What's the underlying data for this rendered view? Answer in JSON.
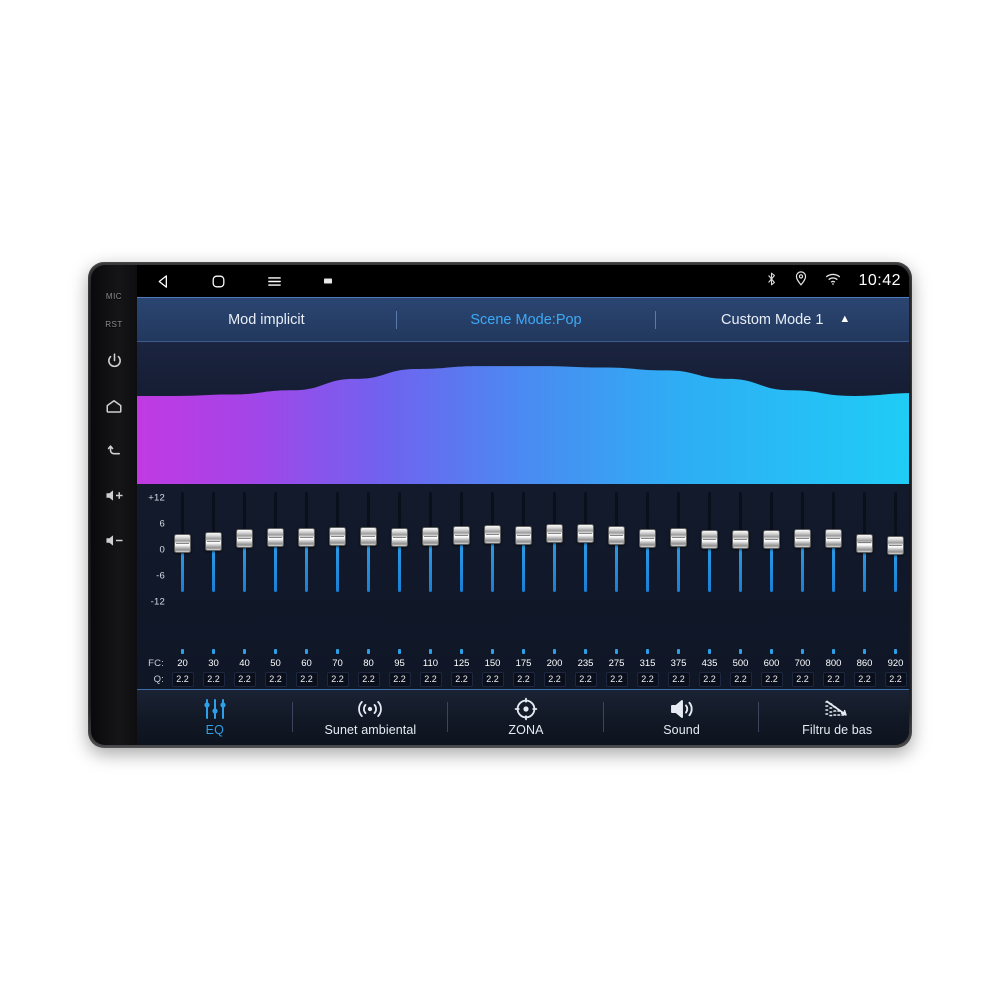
{
  "device": {
    "bezel_buttons": [
      {
        "name": "mic-label",
        "label": "MIC",
        "type": "text"
      },
      {
        "name": "reset-label",
        "label": "RST",
        "type": "text"
      },
      {
        "name": "power-button",
        "label": "power-icon",
        "type": "icon"
      },
      {
        "name": "home-button",
        "label": "home-icon",
        "type": "icon"
      },
      {
        "name": "back-button",
        "label": "back-arrow-icon",
        "type": "icon"
      },
      {
        "name": "volume-up-button",
        "label": "volume-up-icon",
        "type": "icon"
      },
      {
        "name": "volume-down-button",
        "label": "volume-down-icon",
        "type": "icon"
      }
    ]
  },
  "statusbar": {
    "nav": [
      {
        "name": "android-back-icon",
        "label": "back-triangle-icon"
      },
      {
        "name": "android-home-icon",
        "label": "home-rounded-square-icon"
      },
      {
        "name": "android-menu-icon",
        "label": "hamburger-menu-icon"
      },
      {
        "name": "android-recents-icon",
        "label": "recents-square-icon"
      }
    ],
    "icons": [
      {
        "name": "bluetooth-icon",
        "label": "bluetooth-icon"
      },
      {
        "name": "location-icon",
        "label": "location-pin-icon"
      },
      {
        "name": "wifi-icon",
        "label": "wifi-icon"
      }
    ],
    "clock": "10:42"
  },
  "mode_bar": {
    "items": [
      {
        "label": "Mod implicit",
        "active": false
      },
      {
        "label": "Scene Mode:Pop",
        "active": true
      },
      {
        "label": "Custom Mode 1",
        "active": false
      }
    ],
    "expand_caret": "▲"
  },
  "colors": {
    "accent": "#2f9fe8",
    "curve_start": "#b93ce0",
    "curve_mid": "#4a7df0",
    "curve_end": "#22c8f5",
    "header_bg": "#274069",
    "screen_bg": "#0f1626"
  },
  "chart_data": {
    "type": "area",
    "title": "EQ Response Curve",
    "xlabel": "",
    "ylabel": "",
    "grid": false,
    "legend": "none",
    "x": [
      0,
      5,
      12,
      20,
      28,
      36,
      44,
      52,
      60,
      68,
      76,
      84,
      92,
      100
    ],
    "values": [
      62,
      62,
      63,
      66,
      74,
      81,
      83,
      83,
      82,
      80,
      74,
      66,
      62,
      64
    ],
    "ylim": [
      0,
      100
    ]
  },
  "equalizer": {
    "scale_labels": [
      "+12",
      "6",
      "0",
      "-6",
      "-12"
    ],
    "scale_min": -12,
    "scale_max": 12,
    "fc_key": "FC:",
    "q_key": "Q:",
    "bands": [
      {
        "fc": "20",
        "q": "2.2",
        "gain": -0.4
      },
      {
        "fc": "30",
        "q": "2.2",
        "gain": 0.2
      },
      {
        "fc": "40",
        "q": "2.2",
        "gain": 1.0
      },
      {
        "fc": "50",
        "q": "2.2",
        "gain": 1.4
      },
      {
        "fc": "60",
        "q": "2.2",
        "gain": 1.3
      },
      {
        "fc": "70",
        "q": "2.2",
        "gain": 1.5
      },
      {
        "fc": "80",
        "q": "2.2",
        "gain": 1.6
      },
      {
        "fc": "95",
        "q": "2.2",
        "gain": 1.4
      },
      {
        "fc": "110",
        "q": "2.2",
        "gain": 1.7
      },
      {
        "fc": "125",
        "q": "2.2",
        "gain": 1.8
      },
      {
        "fc": "150",
        "q": "2.2",
        "gain": 2.1
      },
      {
        "fc": "175",
        "q": "2.2",
        "gain": 2.0
      },
      {
        "fc": "200",
        "q": "2.2",
        "gain": 2.6
      },
      {
        "fc": "235",
        "q": "2.2",
        "gain": 2.4
      },
      {
        "fc": "275",
        "q": "2.2",
        "gain": 1.9
      },
      {
        "fc": "315",
        "q": "2.2",
        "gain": 1.0
      },
      {
        "fc": "375",
        "q": "2.2",
        "gain": 1.2
      },
      {
        "fc": "435",
        "q": "2.2",
        "gain": 0.6
      },
      {
        "fc": "500",
        "q": "2.2",
        "gain": 0.7
      },
      {
        "fc": "600",
        "q": "2.2",
        "gain": 0.8
      },
      {
        "fc": "700",
        "q": "2.2",
        "gain": 0.9
      },
      {
        "fc": "800",
        "q": "2.2",
        "gain": 1.0
      },
      {
        "fc": "860",
        "q": "2.2",
        "gain": -0.3
      },
      {
        "fc": "920",
        "q": "2.2",
        "gain": -1.1
      }
    ]
  },
  "tabs": [
    {
      "label": "EQ",
      "icon": "equalizer-sliders-icon",
      "active": true
    },
    {
      "label": "Sunet ambiental",
      "icon": "surround-sound-icon",
      "active": false
    },
    {
      "label": "ZONA",
      "icon": "zone-target-icon",
      "active": false
    },
    {
      "label": "Sound",
      "icon": "speaker-volume-icon",
      "active": false
    },
    {
      "label": "Filtru de bas",
      "icon": "bass-filter-icon",
      "active": false
    }
  ]
}
